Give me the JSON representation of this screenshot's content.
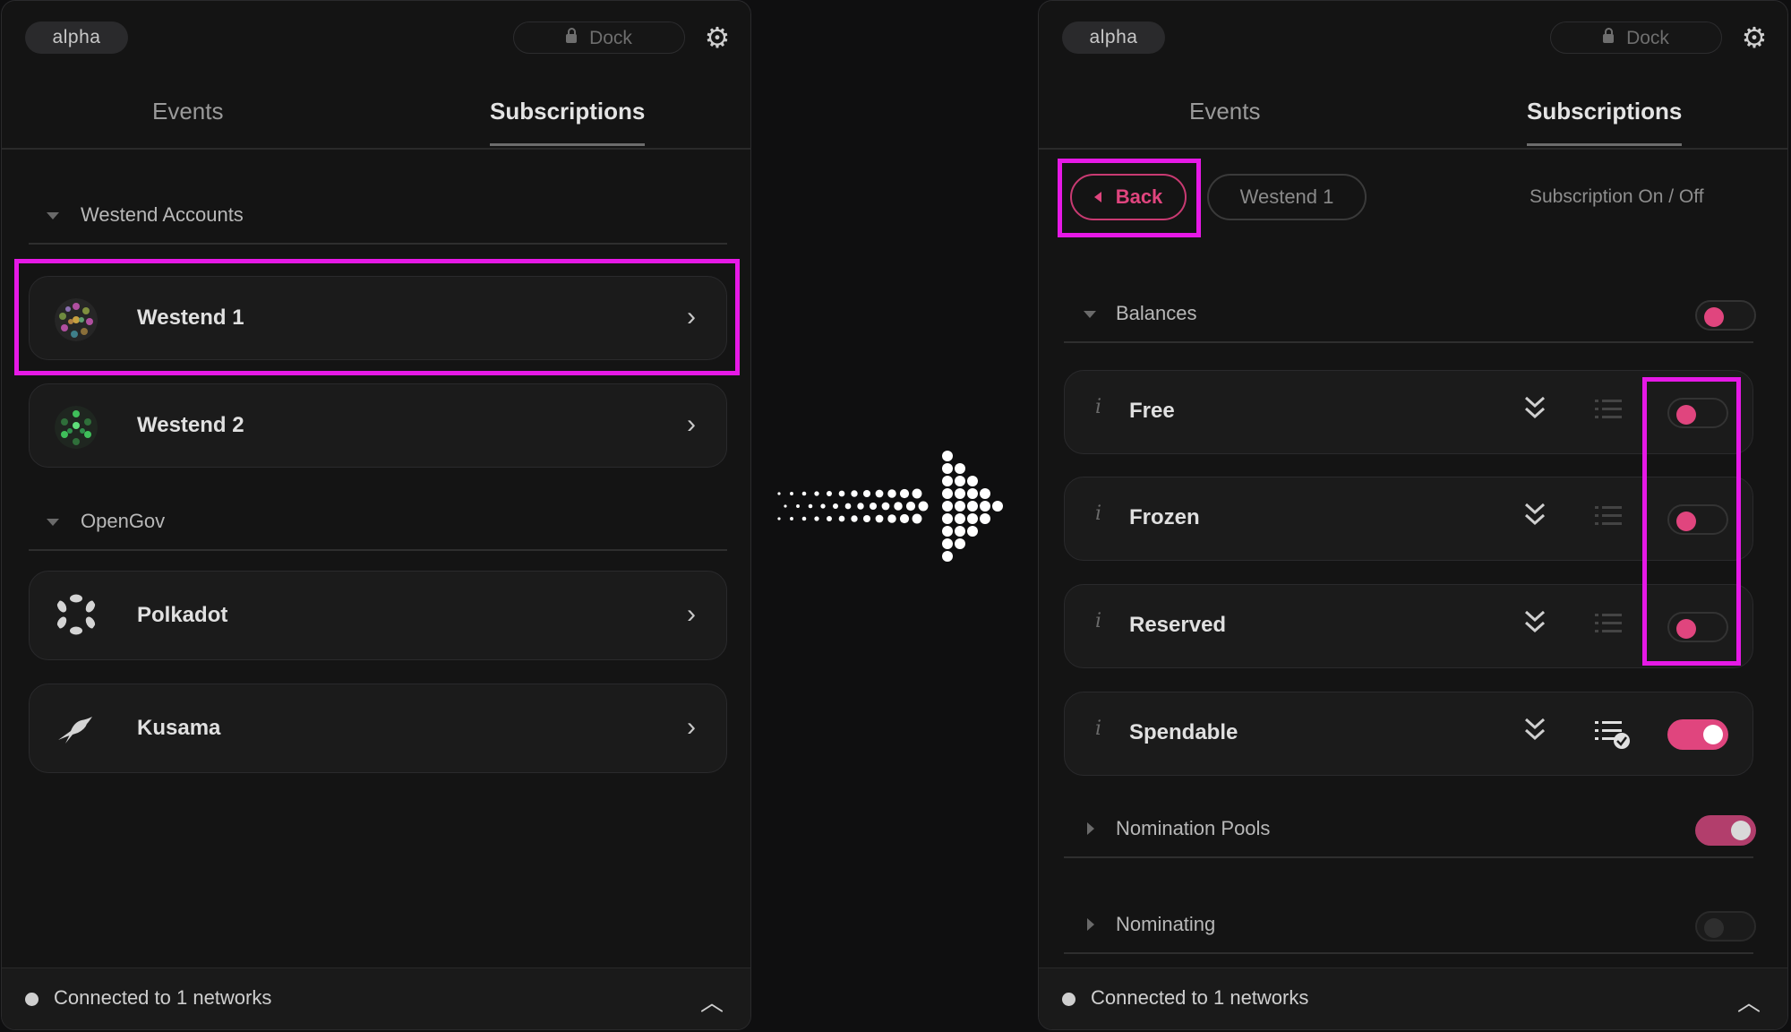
{
  "left_panel": {
    "badge": "alpha",
    "dock_label": "Dock",
    "tabs": {
      "events": "Events",
      "subscriptions": "Subscriptions"
    },
    "groups": [
      {
        "label": "Westend Accounts",
        "accounts": [
          {
            "name": "Westend 1"
          },
          {
            "name": "Westend 2"
          }
        ]
      },
      {
        "label": "OpenGov",
        "accounts": [
          {
            "name": "Polkadot"
          },
          {
            "name": "Kusama"
          }
        ]
      }
    ],
    "footer": "Connected to 1 networks"
  },
  "right_panel": {
    "badge": "alpha",
    "dock_label": "Dock",
    "tabs": {
      "events": "Events",
      "subscriptions": "Subscriptions"
    },
    "back_label": "Back",
    "breadcrumb": "Westend 1",
    "toggle_heading": "Subscription On / Off",
    "balances": {
      "label": "Balances",
      "group_toggle": "off",
      "items": [
        {
          "label": "Free",
          "info": "i",
          "toggle": "off"
        },
        {
          "label": "Frozen",
          "info": "i",
          "toggle": "off"
        },
        {
          "label": "Reserved",
          "info": "i",
          "toggle": "off"
        },
        {
          "label": "Spendable",
          "info": "i",
          "toggle": "on"
        }
      ]
    },
    "nomination_pools": {
      "label": "Nomination Pools",
      "toggle": "on"
    },
    "nominating": {
      "label": "Nominating",
      "toggle": "disabled"
    },
    "footer": "Connected to 1 networks"
  },
  "colors": {
    "accent": "#e0457e",
    "highlight": "#e619e6",
    "background": "#0f0f10"
  },
  "icons": [
    "lock-icon",
    "gear-icon",
    "chevron-right-icon",
    "chevron-up-icon",
    "double-chevron-down-icon",
    "list-icon",
    "list-check-icon",
    "arrow-right-icon"
  ]
}
